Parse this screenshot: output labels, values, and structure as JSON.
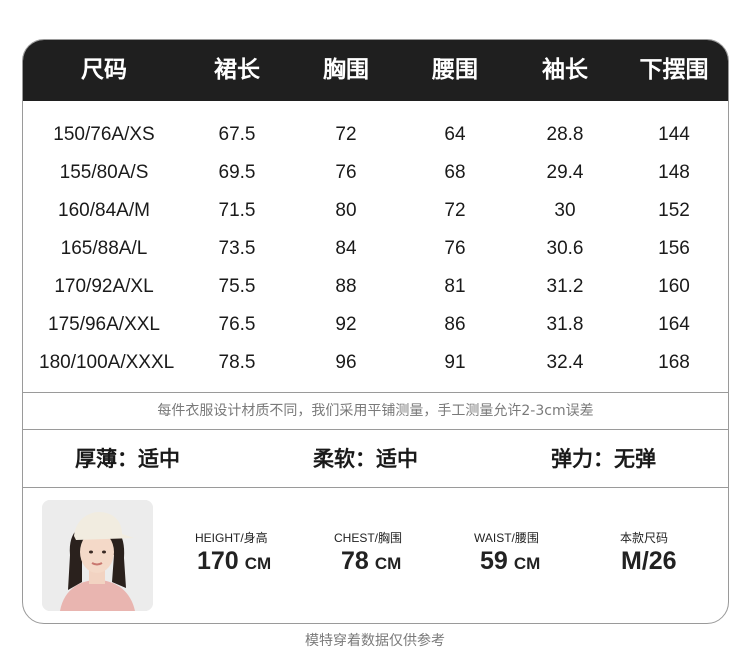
{
  "table": {
    "headers": [
      "尺码",
      "裙长",
      "胸围",
      "腰围",
      "袖长",
      "下摆围"
    ],
    "rows": [
      [
        "150/76A/XS",
        "67.5",
        "72",
        "64",
        "28.8",
        "144"
      ],
      [
        "155/80A/S",
        "69.5",
        "76",
        "68",
        "29.4",
        "148"
      ],
      [
        "160/84A/M",
        "71.5",
        "80",
        "72",
        "30",
        "152"
      ],
      [
        "165/88A/L",
        "73.5",
        "84",
        "76",
        "30.6",
        "156"
      ],
      [
        "170/92A/XL",
        "75.5",
        "88",
        "81",
        "31.2",
        "160"
      ],
      [
        "175/96A/XXL",
        "76.5",
        "92",
        "86",
        "31.8",
        "164"
      ],
      [
        "180/100A/XXXL",
        "78.5",
        "96",
        "91",
        "32.4",
        "168"
      ]
    ]
  },
  "note": "每件衣服设计材质不同，我们采用平铺测量，手工测量允许2-3cm误差",
  "properties": [
    {
      "label": "厚薄",
      "value": "适中"
    },
    {
      "label": "柔软",
      "value": "适中"
    },
    {
      "label": "弹力",
      "value": "无弹"
    }
  ],
  "model": {
    "height_label": "HEIGHT/身高",
    "height_value": "170",
    "height_unit": "CM",
    "chest_label": "CHEST/胸围",
    "chest_value": "78",
    "chest_unit": "CM",
    "waist_label": "WAIST/腰围",
    "waist_value": "59",
    "waist_unit": "CM",
    "size_label": "本款尺码",
    "size_value": "M/26"
  },
  "footer": "模特穿着数据仅供参考"
}
